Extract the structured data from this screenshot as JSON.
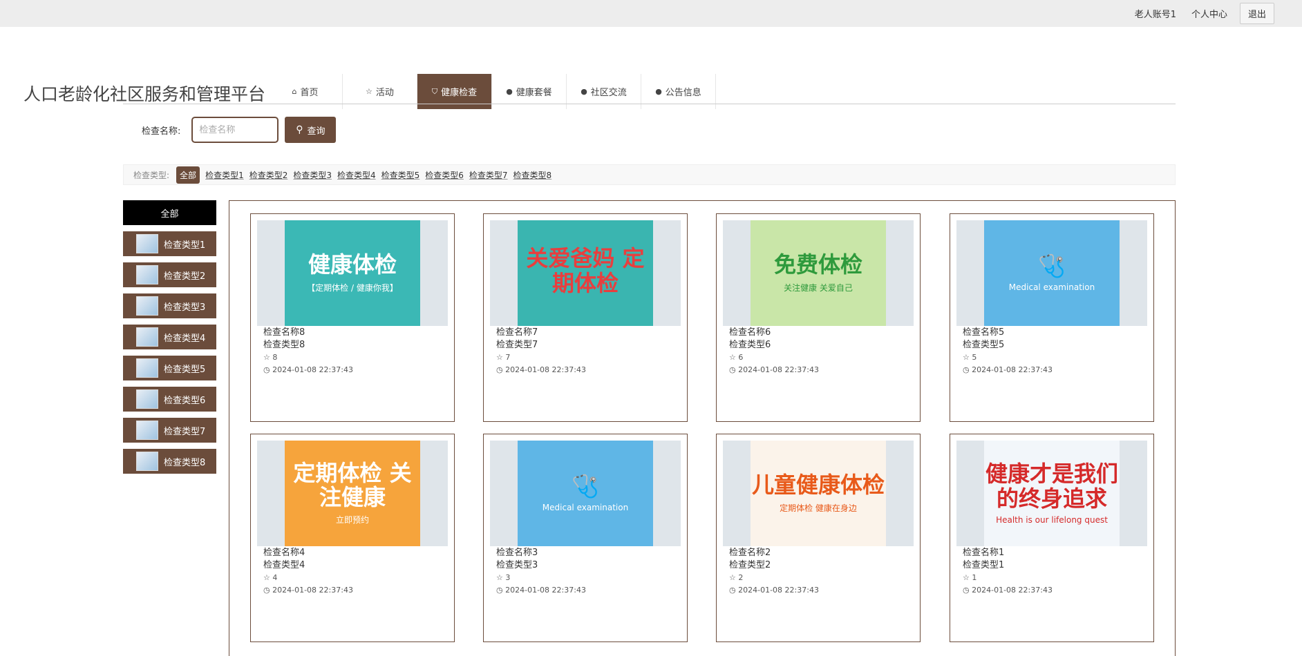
{
  "topbar": {
    "account": "老人账号1",
    "personal_center": "个人中心",
    "logout": "退出"
  },
  "site_title": "人口老龄化社区服务和管理平台",
  "nav": [
    {
      "label": "首页",
      "icon": "home-icon",
      "glyph": "⌂",
      "active": false
    },
    {
      "label": "活动",
      "icon": "star-icon",
      "glyph": "☆",
      "active": false
    },
    {
      "label": "健康检查",
      "icon": "bag-icon",
      "glyph": "⛉",
      "active": true
    },
    {
      "label": "健康套餐",
      "icon": "alert-circle-icon",
      "glyph": "●",
      "active": false
    },
    {
      "label": "社区交流",
      "icon": "help-circle-icon",
      "glyph": "●",
      "active": false
    },
    {
      "label": "公告信息",
      "icon": "info-circle-icon",
      "glyph": "●",
      "active": false
    }
  ],
  "search": {
    "label": "检查名称:",
    "placeholder": "检查名称",
    "button": "查询"
  },
  "filter": {
    "label": "检查类型:",
    "items": [
      "全部",
      "检查类型1",
      "检查类型2",
      "检查类型3",
      "检查类型4",
      "检查类型5",
      "检查类型6",
      "检查类型7",
      "检查类型8"
    ]
  },
  "sidebar": {
    "all": "全部",
    "items": [
      "检查类型1",
      "检查类型2",
      "检查类型3",
      "检查类型4",
      "检查类型5",
      "检查类型6",
      "检查类型7",
      "检查类型8"
    ]
  },
  "cards": [
    {
      "name": "检查名称8",
      "type": "检查类型8",
      "count": "8",
      "time": "2024-01-08 22:37:43",
      "poster_title": "健康体检",
      "poster_sub": "【定期体检 / 健康你我】",
      "bg": "#3bb8b5",
      "fg": "#ffffff"
    },
    {
      "name": "检查名称7",
      "type": "检查类型7",
      "count": "7",
      "time": "2024-01-08 22:37:43",
      "poster_title": "关爱爸妈 定期体检",
      "poster_sub": "",
      "bg": "#3ab5b0",
      "fg": "#e83e3e"
    },
    {
      "name": "检查名称6",
      "type": "检查类型6",
      "count": "6",
      "time": "2024-01-08 22:37:43",
      "poster_title": "免费体检",
      "poster_sub": "关注健康 关爱自己",
      "bg": "#c9e6a8",
      "fg": "#2e9a3c"
    },
    {
      "name": "检查名称5",
      "type": "检查类型5",
      "count": "5",
      "time": "2024-01-08 22:37:43",
      "poster_title": "🩺",
      "poster_sub": "Medical examination",
      "bg": "#5fb6e6",
      "fg": "#ffffff"
    },
    {
      "name": "检查名称4",
      "type": "检查类型4",
      "count": "4",
      "time": "2024-01-08 22:37:43",
      "poster_title": "定期体检 关注健康",
      "poster_sub": "立即预约",
      "bg": "#f6a43c",
      "fg": "#ffffff"
    },
    {
      "name": "检查名称3",
      "type": "检查类型3",
      "count": "3",
      "time": "2024-01-08 22:37:43",
      "poster_title": "🩺",
      "poster_sub": "Medical examination",
      "bg": "#5fb6e6",
      "fg": "#ffffff"
    },
    {
      "name": "检查名称2",
      "type": "检查类型2",
      "count": "2",
      "time": "2024-01-08 22:37:43",
      "poster_title": "儿童健康体检",
      "poster_sub": "定期体检 健康在身边",
      "bg": "#fbf3ea",
      "fg": "#e85a1a"
    },
    {
      "name": "检查名称1",
      "type": "检查类型1",
      "count": "1",
      "time": "2024-01-08 22:37:43",
      "poster_title": "健康才是我们的终身追求",
      "poster_sub": "Health is our lifelong quest",
      "bg": "#f2f6fa",
      "fg": "#d52a2a"
    }
  ],
  "colors": {
    "brand": "#6b4c3b",
    "topbar_bg": "#ededed"
  }
}
